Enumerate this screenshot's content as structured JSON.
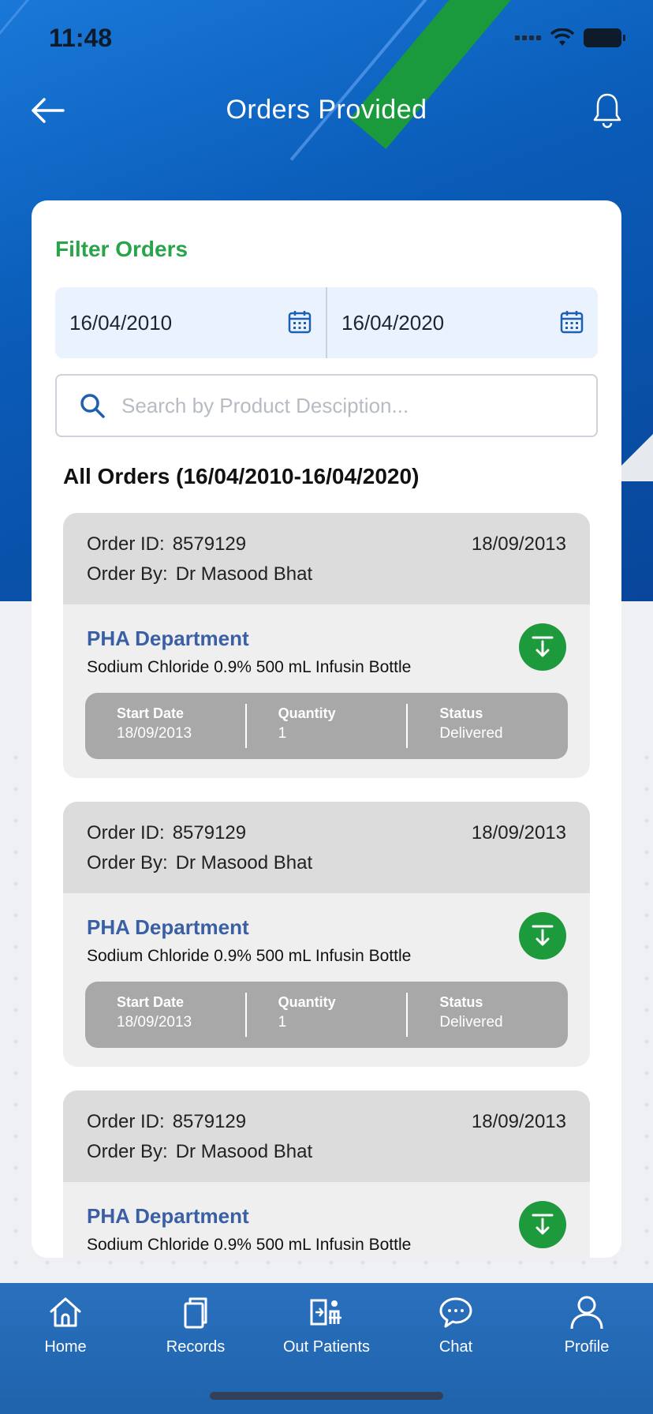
{
  "status_bar": {
    "time": "11:48"
  },
  "header": {
    "title": "Orders Provided"
  },
  "filter": {
    "title": "Filter Orders",
    "date_from": "16/04/2010",
    "date_to": "16/04/2020",
    "search_placeholder": "Search by Product Desciption..."
  },
  "orders_heading": "All Orders (16/04/2010-16/04/2020)",
  "orders": [
    {
      "id_label": "Order ID:",
      "id": "8579129",
      "by_label": "Order By:",
      "by": "Dr Masood Bhat",
      "date": "18/09/2013",
      "department": "PHA Department",
      "product": "Sodium Chloride 0.9% 500 mL Infusin Bottle",
      "start_date_label": "Start Date",
      "start_date": "18/09/2013",
      "quantity_label": "Quantity",
      "quantity": "1",
      "status_label": "Status",
      "status": "Delivered"
    },
    {
      "id_label": "Order ID:",
      "id": "8579129",
      "by_label": "Order By:",
      "by": "Dr Masood Bhat",
      "date": "18/09/2013",
      "department": "PHA Department",
      "product": "Sodium Chloride 0.9% 500 mL Infusin Bottle",
      "start_date_label": "Start Date",
      "start_date": "18/09/2013",
      "quantity_label": "Quantity",
      "quantity": "1",
      "status_label": "Status",
      "status": "Delivered"
    },
    {
      "id_label": "Order ID:",
      "id": "8579129",
      "by_label": "Order By:",
      "by": "Dr Masood Bhat",
      "date": "18/09/2013",
      "department": "PHA Department",
      "product": "Sodium Chloride 0.9% 500 mL Infusin Bottle"
    }
  ],
  "nav": [
    {
      "label": "Home",
      "icon": "home-icon"
    },
    {
      "label": "Records",
      "icon": "records-icon"
    },
    {
      "label": "Out Patients",
      "icon": "out-patients-icon"
    },
    {
      "label": "Chat",
      "icon": "chat-icon"
    },
    {
      "label": "Profile",
      "icon": "profile-icon"
    }
  ],
  "colors": {
    "primary_blue": "#0a5cb8",
    "accent_green": "#2aa44a",
    "nav_blue": "#2a70bd",
    "dept_blue": "#3a5fa5"
  }
}
